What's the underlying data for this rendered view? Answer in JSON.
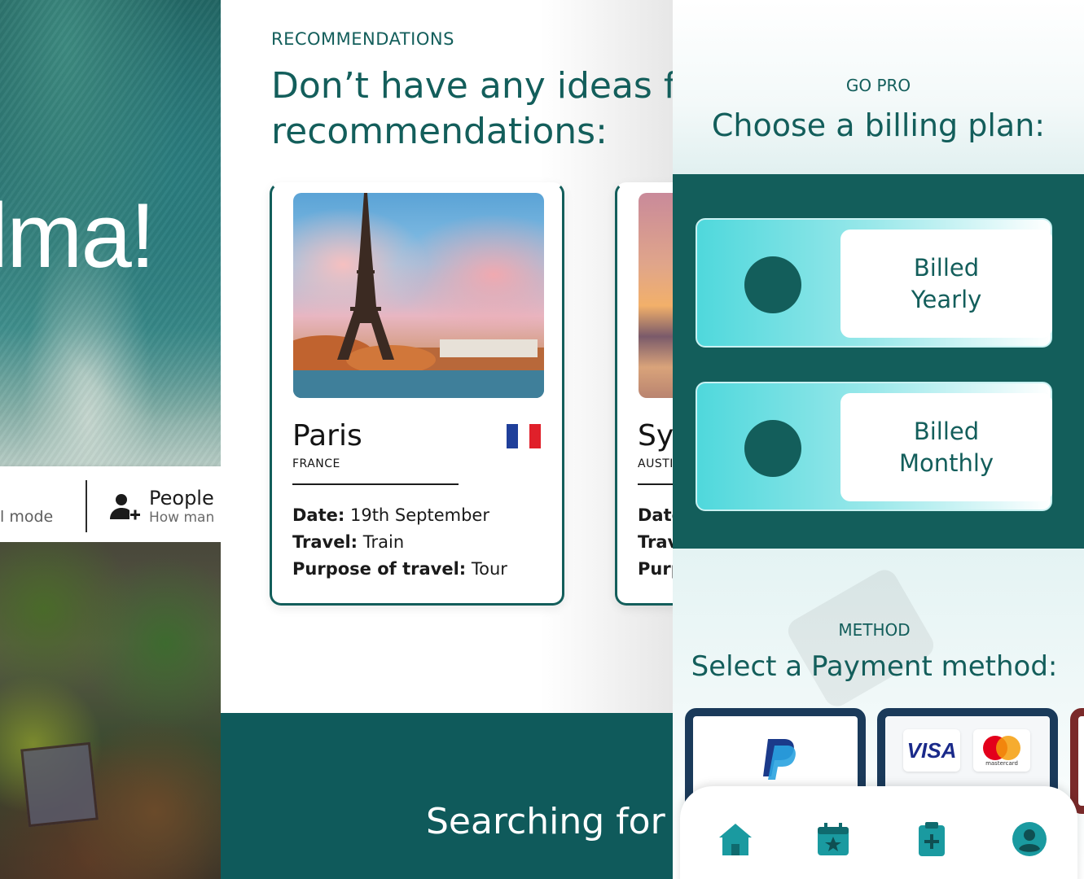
{
  "hero": {
    "greeting": "elma!",
    "mode_label": "l mode",
    "people_label": "People",
    "people_sub": "How man",
    "icons": {
      "people": "add-person-icon"
    }
  },
  "recommendations": {
    "kicker": "RECOMMENDATIONS",
    "title_line1": "Don’t have any ideas fo",
    "title_line2": "recommendations:",
    "cards": [
      {
        "name": "Paris",
        "country": "FRANCE",
        "flag_colors": [
          "#1f3f9a",
          "#ffffff",
          "#e0202a"
        ],
        "date_label": "Date:",
        "date_value": " 19th September",
        "travel_label": "Travel:",
        "travel_value": " Train",
        "purpose_label": "Purpose of travel:",
        "purpose_value": " Tour"
      },
      {
        "name": "Sy",
        "country": "AUSTI",
        "date_label": "Date",
        "travel_label": "Trav",
        "purpose_label": "Purp"
      }
    ],
    "footer_text": "Searching for a"
  },
  "billing": {
    "kicker": "GO PRO",
    "title": "Choose a billing plan:",
    "plans": [
      {
        "label_line1": "Billed",
        "label_line2": "Yearly"
      },
      {
        "label_line1": "Billed",
        "label_line2": "Monthly"
      }
    ]
  },
  "payment": {
    "kicker": "METHOD",
    "title": "Select a Payment method:",
    "visa_label": "VISA",
    "mastercard_label": "mastercard"
  },
  "bottom_nav": {
    "items": [
      {
        "icon": "home-icon"
      },
      {
        "icon": "calendar-star-icon"
      },
      {
        "icon": "clipboard-plus-icon"
      },
      {
        "icon": "profile-icon"
      }
    ]
  },
  "colors": {
    "brand_teal": "#135e5b",
    "accent_cyan": "#4fd8dc",
    "footer_teal": "#0f5a5b"
  }
}
